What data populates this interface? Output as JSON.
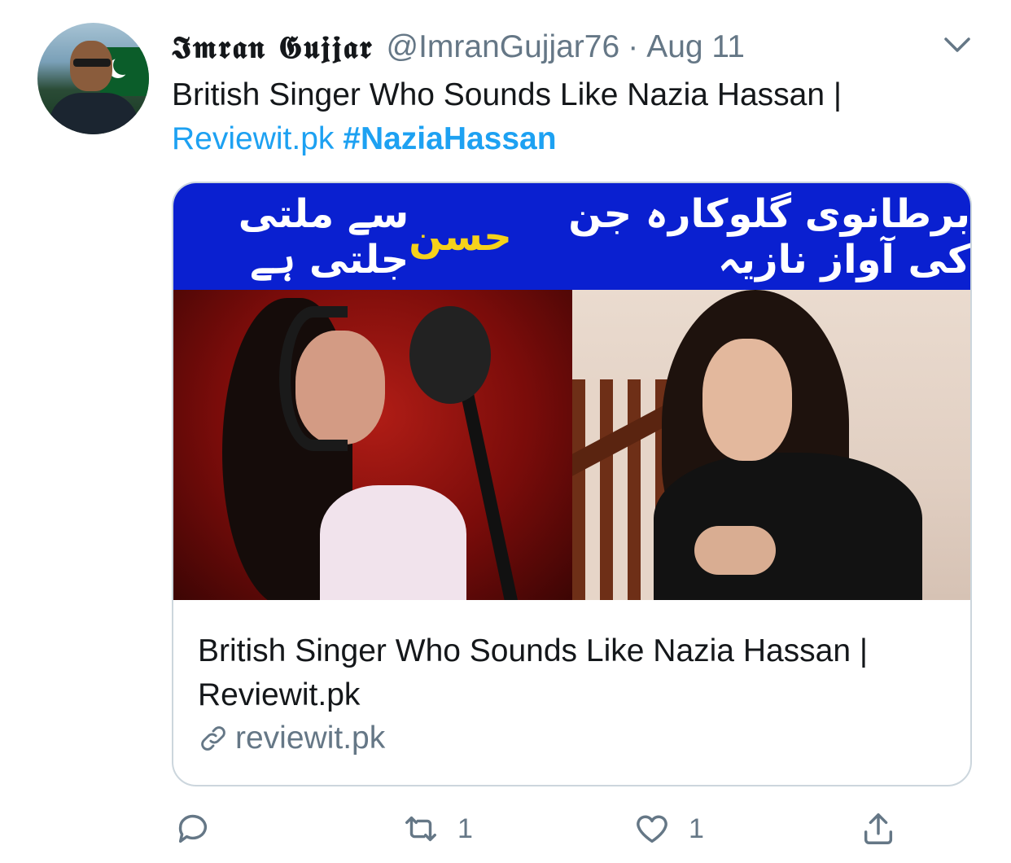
{
  "tweet": {
    "author_name": "𝕴𝖒𝖗𝖆𝖓 𝕲𝖚𝖏𝖏𝖆𝖗",
    "handle": "@ImranGujjar76",
    "separator": "·",
    "date": "Aug 11",
    "text": "British Singer Who Sounds Like Nazia Hassan |",
    "link_text": "Reviewit.pk",
    "hashtag": "#NaziaHassan"
  },
  "card": {
    "banner_part1": "برطانوی گلوکارہ جن کی آواز نازیہ ",
    "banner_highlight": "حسن",
    "banner_part2": " سے ملتی جلتی ہے",
    "title": "British Singer Who Sounds Like Nazia Hassan | Reviewit.pk",
    "domain": "reviewit.pk"
  },
  "actions": {
    "retweet_count": "1",
    "like_count": "1"
  },
  "colors": {
    "accent": "#1da1f2",
    "secondary_text": "#657786",
    "banner_blue": "#0a20d0",
    "banner_yellow": "#f6d21a"
  },
  "icons": [
    "chevron-down-icon",
    "link-icon",
    "reply-icon",
    "retweet-icon",
    "like-icon",
    "share-icon"
  ]
}
